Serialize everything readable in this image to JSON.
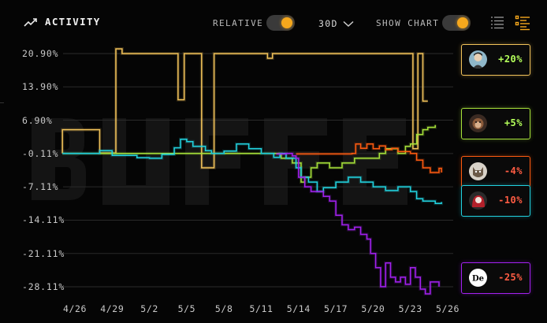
{
  "header": {
    "title": "ACTIVITY",
    "relative_label": "RELATIVE",
    "relative_on": true,
    "period": "30D",
    "show_chart_label": "SHOW CHART",
    "show_chart_on": true
  },
  "icons": {
    "title": "trending-up-icon",
    "period": "chevron-down-icon",
    "list_view": "list-icon",
    "detail_view": "list-detail-icon"
  },
  "colors": {
    "accent": "#f6a81d",
    "background": "#050505",
    "gold": "#f2c35a",
    "lime": "#a7e23a",
    "orange": "#ff5b10",
    "cyan": "#22d3e0",
    "purple": "#a321f0"
  },
  "legend_cards": [
    {
      "percent": "+20%",
      "color": "#f2c35a",
      "text_color": "#b4ff5a",
      "avatar": "portrait-avatar"
    },
    {
      "percent": "+5%",
      "color": "#a7e23a",
      "text_color": "#b4ff5a",
      "avatar": "monkey-avatar"
    },
    {
      "percent": "-4%",
      "color": "#ff5b10",
      "text_color": "#ff5c43",
      "avatar": "cat-avatar"
    },
    {
      "percent": "-10%",
      "color": "#22d3e0",
      "text_color": "#ff5c43",
      "avatar": "red-hair-avatar"
    },
    {
      "percent": "-25%",
      "color": "#a321f0",
      "text_color": "#ff5c43",
      "avatar": "de-logo-avatar",
      "avatar_text": "De"
    }
  ],
  "chart_data": {
    "type": "line",
    "y_ticks": [
      "20.90%",
      "13.90%",
      "6.90%",
      "-0.11%",
      "-7.11%",
      "-14.11%",
      "-21.11%",
      "-28.11%"
    ],
    "y_values": [
      20.9,
      13.9,
      6.9,
      -0.11,
      -7.11,
      -14.11,
      -21.11,
      -28.11
    ],
    "ylim": [
      -31,
      23
    ],
    "x_ticks": [
      "4/26",
      "4/29",
      "5/2",
      "5/5",
      "5/8",
      "5/11",
      "5/14",
      "5/17",
      "5/20",
      "5/23",
      "5/26"
    ],
    "x_range": [
      0,
      30
    ],
    "grid": "horizontal",
    "series": [
      {
        "color": "#f2c35a",
        "points": [
          [
            -1,
            -0.1
          ],
          [
            -1,
            4.9
          ],
          [
            2,
            4.9
          ],
          [
            2,
            0
          ],
          [
            3.3,
            0
          ],
          [
            3.3,
            21.9
          ],
          [
            3.8,
            21.9
          ],
          [
            3.8,
            20.9
          ],
          [
            8.3,
            20.9
          ],
          [
            8.3,
            11.2
          ],
          [
            8.8,
            11.2
          ],
          [
            8.8,
            20.9
          ],
          [
            10.2,
            20.9
          ],
          [
            10.2,
            -3.1
          ],
          [
            11.2,
            -3.1
          ],
          [
            11.2,
            20.9
          ],
          [
            15.5,
            20.9
          ],
          [
            15.5,
            19.9
          ],
          [
            15.9,
            19.9
          ],
          [
            15.9,
            20.9
          ],
          [
            27.2,
            20.9
          ],
          [
            27.2,
            0.9
          ],
          [
            27.6,
            0.9
          ],
          [
            27.6,
            20.9
          ],
          [
            28.0,
            20.9
          ],
          [
            28.0,
            10.9
          ],
          [
            28.4,
            10.9
          ]
        ]
      },
      {
        "color": "#a7e23a",
        "points": [
          [
            -1,
            -0.1
          ],
          [
            16.2,
            -0.1
          ],
          [
            16.6,
            -1.1
          ],
          [
            17.5,
            -2.1
          ],
          [
            18.2,
            -6.1
          ],
          [
            18.5,
            -5.1
          ],
          [
            19.0,
            -3.1
          ],
          [
            19.5,
            -2.1
          ],
          [
            20.5,
            -3.1
          ],
          [
            21.5,
            -2.1
          ],
          [
            22.5,
            -1.1
          ],
          [
            23.5,
            -1.1
          ],
          [
            24.5,
            -0.1
          ],
          [
            25.0,
            0.9
          ],
          [
            26.0,
            -0.1
          ],
          [
            26.6,
            1.4
          ],
          [
            27.0,
            1.9
          ],
          [
            27.5,
            3.9
          ],
          [
            28.0,
            4.9
          ],
          [
            28.4,
            5.4
          ],
          [
            29.0,
            5.9
          ]
        ]
      },
      {
        "color": "#ff5b10",
        "points": [
          [
            17.8,
            -0.2
          ],
          [
            22.3,
            -0.1
          ],
          [
            22.6,
            1.9
          ],
          [
            23.0,
            1.0
          ],
          [
            23.5,
            1.9
          ],
          [
            24.0,
            0.9
          ],
          [
            24.5,
            1.5
          ],
          [
            25.0,
            0.7
          ],
          [
            25.5,
            1.0
          ],
          [
            26.0,
            0.3
          ],
          [
            27.0,
            -0.1
          ],
          [
            27.5,
            -1.5
          ],
          [
            28.0,
            -3.1
          ],
          [
            28.6,
            -4.1
          ],
          [
            29.3,
            -3.2
          ],
          [
            29.5,
            -4.1
          ]
        ]
      },
      {
        "color": "#22d3e0",
        "points": [
          [
            -1,
            -0.1
          ],
          [
            1,
            -0.1
          ],
          [
            2,
            0.5
          ],
          [
            3,
            -0.5
          ],
          [
            4,
            -0.5
          ],
          [
            5,
            -1.0
          ],
          [
            6,
            -1.1
          ],
          [
            7,
            -0.3
          ],
          [
            8,
            1.1
          ],
          [
            8.5,
            2.9
          ],
          [
            9.0,
            2.4
          ],
          [
            9.5,
            1.4
          ],
          [
            10.5,
            0.5
          ],
          [
            11.0,
            -0.1
          ],
          [
            12.0,
            0.4
          ],
          [
            13.0,
            1.9
          ],
          [
            14.0,
            0.9
          ],
          [
            15.0,
            -0.1
          ],
          [
            16.0,
            -0.9
          ],
          [
            16.5,
            -0.1
          ],
          [
            17.0,
            -1.1
          ],
          [
            17.8,
            -3.1
          ],
          [
            18.2,
            -5.1
          ],
          [
            18.8,
            -6.1
          ],
          [
            19.5,
            -8.1
          ],
          [
            20.0,
            -7.3
          ],
          [
            21.0,
            -6.1
          ],
          [
            22.0,
            -5.1
          ],
          [
            23.0,
            -6.1
          ],
          [
            24.0,
            -7.1
          ],
          [
            25.0,
            -7.9
          ],
          [
            26.0,
            -7.1
          ],
          [
            27.0,
            -8.1
          ],
          [
            27.5,
            -9.6
          ],
          [
            28.0,
            -10.1
          ],
          [
            29.0,
            -10.6
          ],
          [
            29.5,
            -10.3
          ]
        ]
      },
      {
        "color": "#a321f0",
        "points": [
          [
            16.2,
            -0.2
          ],
          [
            17.0,
            -0.1
          ],
          [
            17.5,
            -0.6
          ],
          [
            17.8,
            -1.1
          ],
          [
            18.0,
            -5.1
          ],
          [
            18.5,
            -7.1
          ],
          [
            19.0,
            -8.1
          ],
          [
            20.0,
            -9.1
          ],
          [
            20.5,
            -10.1
          ],
          [
            21.0,
            -13.1
          ],
          [
            21.5,
            -15.1
          ],
          [
            22.0,
            -16.1
          ],
          [
            22.5,
            -15.6
          ],
          [
            23.0,
            -17.1
          ],
          [
            23.5,
            -18.1
          ],
          [
            23.8,
            -21.1
          ],
          [
            24.2,
            -24.1
          ],
          [
            24.6,
            -28.1
          ],
          [
            25.0,
            -23.1
          ],
          [
            25.4,
            -26.1
          ],
          [
            25.8,
            -27.1
          ],
          [
            26.2,
            -26.1
          ],
          [
            26.6,
            -27.6
          ],
          [
            27.0,
            -24.1
          ],
          [
            27.4,
            -26.1
          ],
          [
            27.8,
            -28.6
          ],
          [
            28.2,
            -29.6
          ],
          [
            28.6,
            -27.1
          ],
          [
            29.3,
            -28.1
          ]
        ]
      }
    ]
  }
}
